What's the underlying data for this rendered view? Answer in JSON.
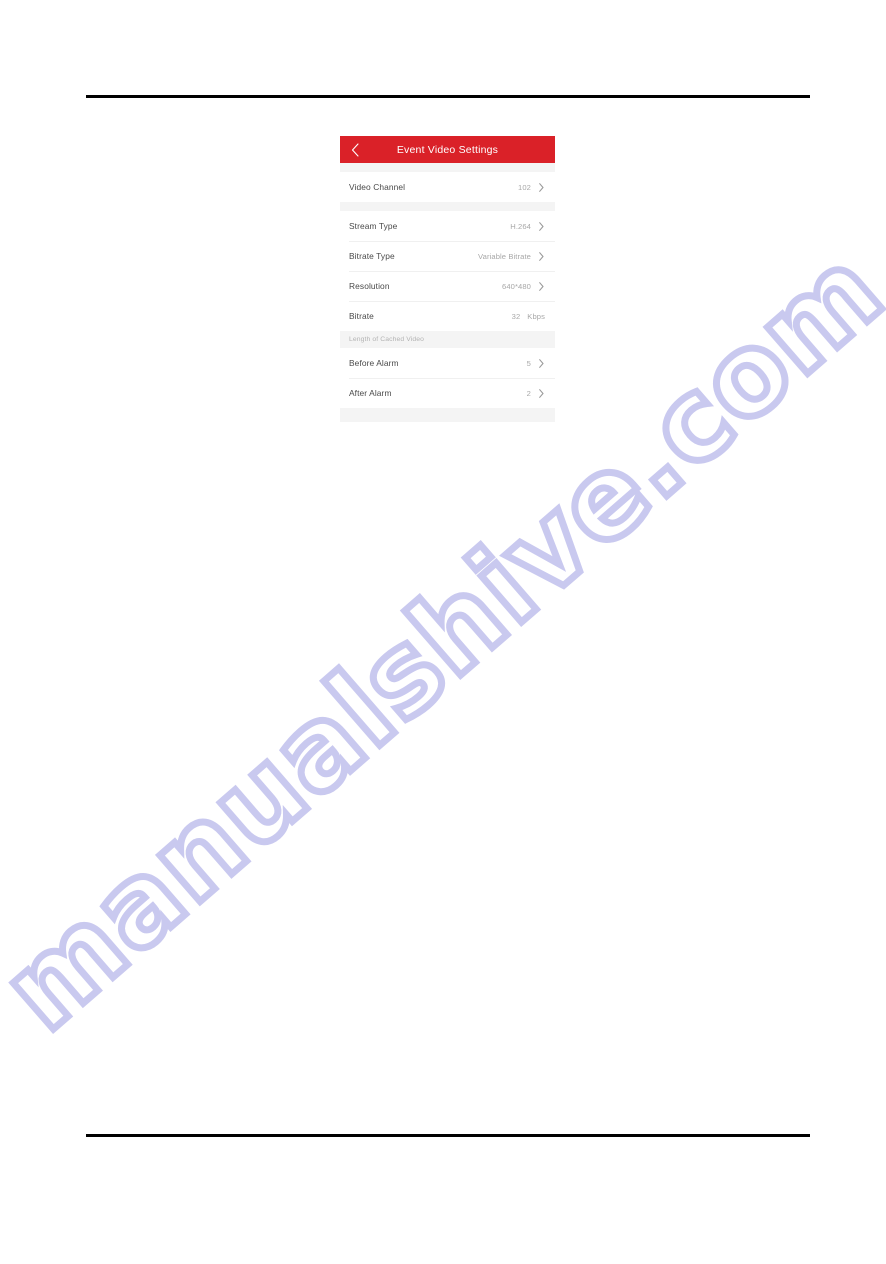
{
  "page": {
    "background": "#ffffff",
    "rule_color": "#000000",
    "watermark": {
      "text": "manualshive.com",
      "color": "#c9c9ef"
    }
  },
  "app": {
    "accent_color": "#da2128",
    "titlebar": {
      "back_icon": "chevron-left-icon",
      "title": "Event Video Settings"
    },
    "sections": [
      {
        "id": "channel",
        "header": null,
        "rows": [
          {
            "label": "Video Channel",
            "value": "102",
            "unit": "",
            "chevron": true
          }
        ]
      },
      {
        "id": "stream",
        "header": null,
        "rows": [
          {
            "label": "Stream Type",
            "value": "H.264",
            "unit": "",
            "chevron": true
          },
          {
            "label": "Bitrate Type",
            "value": "Variable Bitrate",
            "unit": "",
            "chevron": true
          },
          {
            "label": "Resolution",
            "value": "640*480",
            "unit": "",
            "chevron": true
          },
          {
            "label": "Bitrate",
            "value": "32",
            "unit": "Kbps",
            "chevron": false
          }
        ]
      },
      {
        "id": "cached-video",
        "header": "Length of Cached Video",
        "rows": [
          {
            "label": "Before Alarm",
            "value": "5",
            "unit": "",
            "chevron": true
          },
          {
            "label": "After Alarm",
            "value": "2",
            "unit": "",
            "chevron": true
          }
        ]
      }
    ]
  }
}
